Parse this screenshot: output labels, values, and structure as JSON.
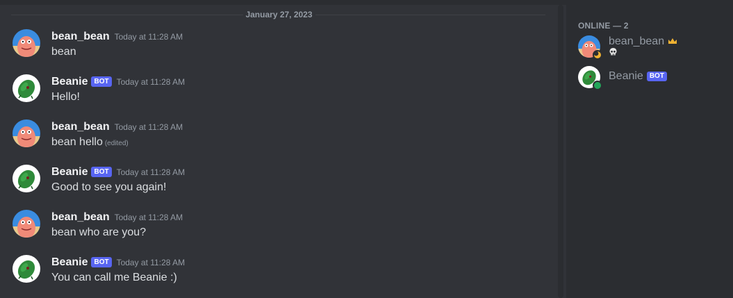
{
  "chat": {
    "date_divider": "January 27, 2023",
    "messages": [
      {
        "author": "bean_bean",
        "is_bot": false,
        "timestamp": "Today at 11:28 AM",
        "text": "bean",
        "edited": ""
      },
      {
        "author": "Beanie",
        "is_bot": true,
        "bot_tag": "BOT",
        "timestamp": "Today at 11:28 AM",
        "text": "Hello!",
        "edited": ""
      },
      {
        "author": "bean_bean",
        "is_bot": false,
        "timestamp": "Today at 11:28 AM",
        "text": "bean hello",
        "edited": "(edited)"
      },
      {
        "author": "Beanie",
        "is_bot": true,
        "bot_tag": "BOT",
        "timestamp": "Today at 11:28 AM",
        "text": "Good to see you again!",
        "edited": ""
      },
      {
        "author": "bean_bean",
        "is_bot": false,
        "timestamp": "Today at 11:28 AM",
        "text": "bean who are you?",
        "edited": ""
      },
      {
        "author": "Beanie",
        "is_bot": true,
        "bot_tag": "BOT",
        "timestamp": "Today at 11:28 AM",
        "text": "You can call me Beanie :)",
        "edited": ""
      }
    ]
  },
  "members": {
    "header": "ONLINE — 2",
    "list": [
      {
        "name": "bean_bean",
        "badge_icon": "crown-icon",
        "status_icon": "skull-icon",
        "presence": "idle",
        "avatar": "patrick-avatar"
      },
      {
        "name": "Beanie",
        "bot_tag": "BOT",
        "presence": "online",
        "avatar": "bean-avatar"
      }
    ]
  },
  "colors": {
    "background": "#313338",
    "sidebar": "#2b2d31",
    "bot_tag": "#5865f2",
    "idle": "#f0b232",
    "online": "#23a55a",
    "crown": "#f0b232"
  }
}
